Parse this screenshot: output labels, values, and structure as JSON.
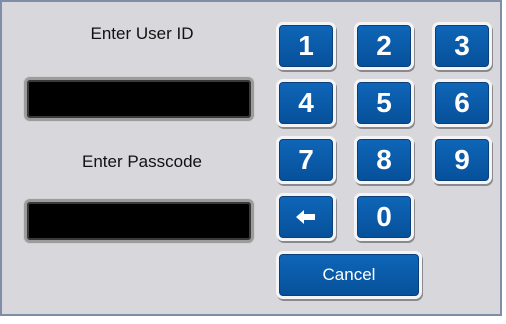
{
  "login": {
    "user_id_label": "Enter User ID",
    "passcode_label": "Enter Passcode",
    "user_id_value": "",
    "passcode_value": ""
  },
  "keypad": {
    "keys": [
      "1",
      "2",
      "3",
      "4",
      "5",
      "6",
      "7",
      "8",
      "9",
      "0"
    ],
    "backspace_icon": "left-arrow-icon",
    "cancel_label": "Cancel"
  },
  "colors": {
    "panel_background": "#d8d8dc",
    "key_blue": "#0a5aa8",
    "field_black": "#000000"
  }
}
